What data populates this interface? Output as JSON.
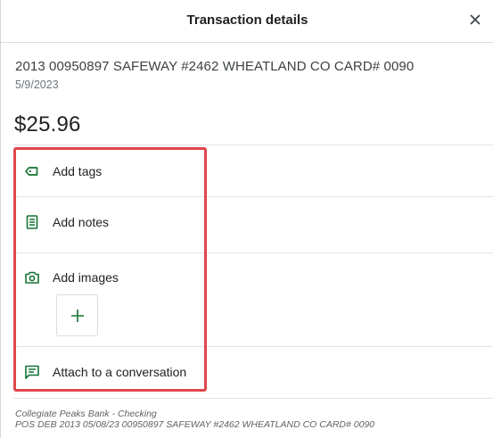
{
  "dialog": {
    "title": "Transaction details",
    "close_icon": "close-icon"
  },
  "transaction": {
    "description": "2013 00950897 SAFEWAY #2462 WHEATLAND CO CARD# 0090",
    "date": "5/9/2023",
    "amount": "$25.96"
  },
  "actions": {
    "tags": {
      "label": "Add tags",
      "icon": "tag-icon"
    },
    "notes": {
      "label": "Add notes",
      "icon": "notes-icon"
    },
    "images": {
      "label": "Add images",
      "icon": "camera-icon",
      "add_button_icon": "plus-icon"
    },
    "conversation": {
      "label": "Attach to a conversation",
      "icon": "chat-icon"
    }
  },
  "footer": {
    "account": "Collegiate Peaks Bank - Checking",
    "raw_description": "POS DEB 2013 05/08/23 00950897 SAFEWAY #2462 WHEATLAND CO CARD# 0090"
  },
  "colors": {
    "accent_green": "#137333",
    "highlight_red": "#e0474c"
  }
}
